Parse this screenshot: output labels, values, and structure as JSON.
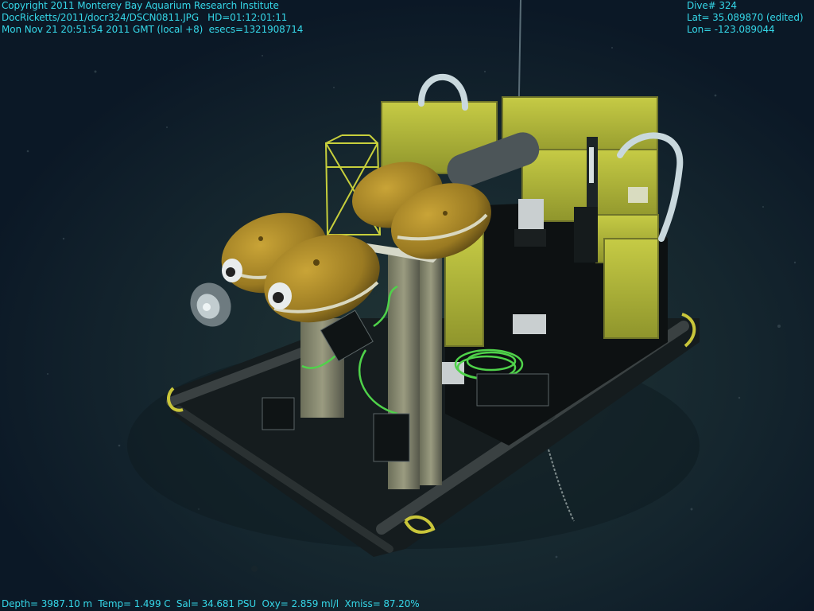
{
  "overlay": {
    "top_left": [
      "Copyright 2011 Monterey Bay Aquarium Research Institute",
      "DocRicketts/2011/docr324/DSCN0811.JPG   HD=01:12:01:11",
      "Mon Nov 21 20:51:54 2011 GMT (local +8)  esecs=1321908714"
    ],
    "top_right": [
      "Dive# 324",
      "Lat= 35.089870 (edited)",
      "Lon= -123.089044"
    ],
    "bottom": "Depth= 3987.10 m  Temp= 1.499 C  Sal= 34.681 PSU  Oxy= 2.859 ml/l  Xmiss= 87.20%"
  },
  "colors": {
    "overlay_text": "#35d7e8",
    "water": "#0c1a28",
    "seafloor": "#1c2e34",
    "float_yellow": "#b8952a",
    "foam_yellow": "#b7bd3a",
    "cable_green": "#4fd24a"
  }
}
